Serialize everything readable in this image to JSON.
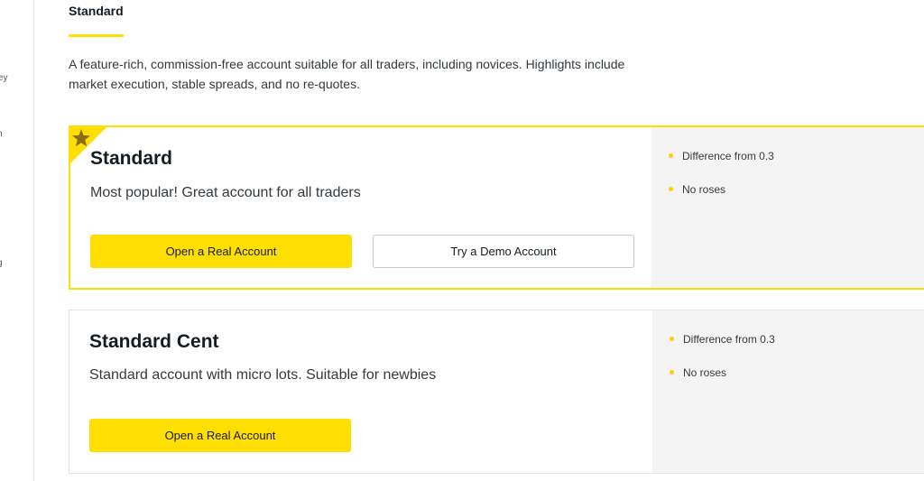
{
  "sidebar": {
    "items": [
      {
        "label": "ney"
      },
      {
        "label": "h"
      },
      {
        "label": "g"
      }
    ]
  },
  "header": {
    "active_tab": "Standard"
  },
  "description": "A feature-rich, commission-free account suitable for all traders, including novices. Highlights include market execution, stable spreads, and no re-quotes.",
  "accounts": [
    {
      "title": "Standard",
      "subtitle": "Most popular! Great account for all traders",
      "primary_button": "Open a Real Account",
      "secondary_button": "Try a Demo Account",
      "features": [
        "Difference from 0.3",
        "No roses"
      ],
      "featured": true
    },
    {
      "title": "Standard Cent",
      "subtitle": "Standard account with micro lots. Suitable for newbies",
      "primary_button": "Open a Real Account",
      "features": [
        "Difference from 0.3",
        "No roses"
      ],
      "featured": false
    }
  ],
  "colors": {
    "accent": "#ffde02",
    "panel": "#f4f4f4",
    "text": "#141d22"
  },
  "icons": {
    "featured": "star-icon"
  }
}
